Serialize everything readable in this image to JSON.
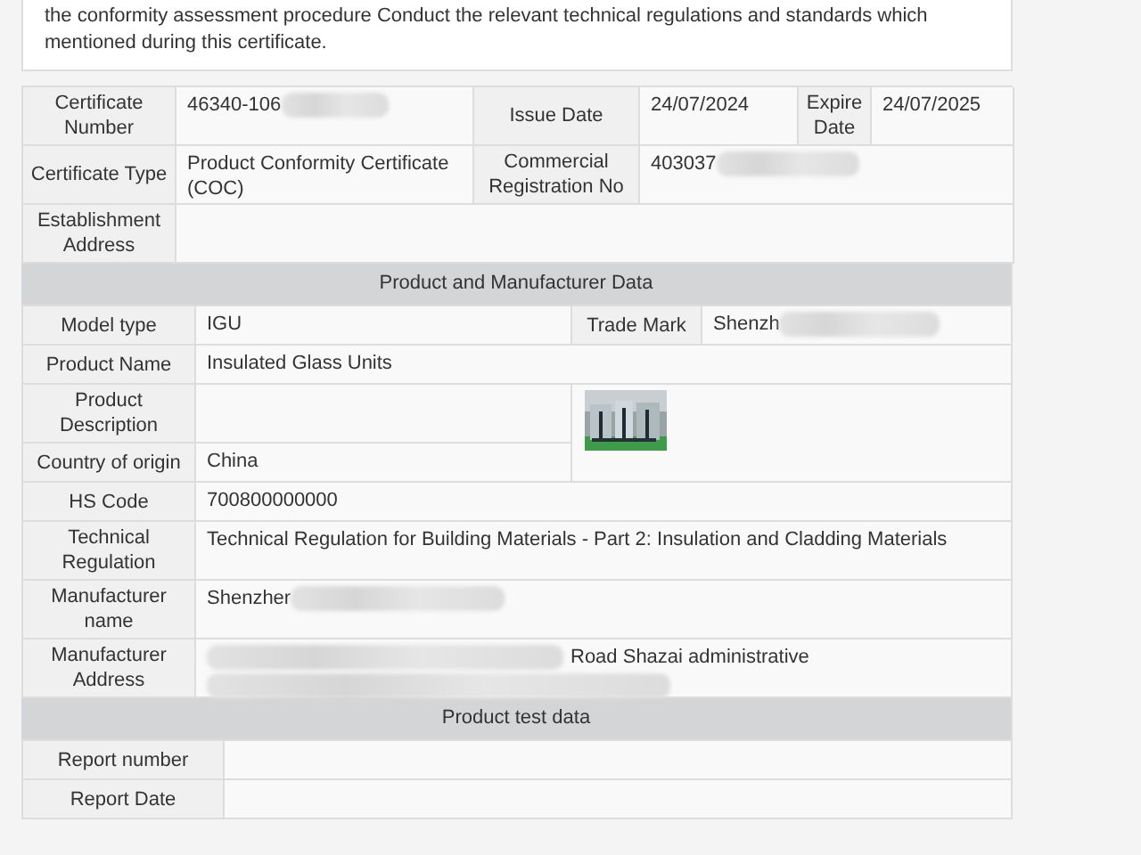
{
  "intro": {
    "lines": [
      "the conformity assessment procedure Conduct the relevant technical regulations and standards which",
      "mentioned during this certificate."
    ]
  },
  "certificate": {
    "certificate_number": {
      "label": "Certificate Number",
      "value": "46340-106"
    },
    "issue_date": {
      "label": "Issue Date",
      "value": "24/07/2024"
    },
    "expire_date": {
      "label": "Expire Date",
      "value": "24/07/2025"
    },
    "certificate_type": {
      "label": "Certificate Type",
      "value": "Product Conformity Certificate (COC)"
    },
    "commercial_registration": {
      "label": "Commercial Registration No",
      "value": "403037"
    },
    "establishment_address": {
      "label": "Establishment Address"
    }
  },
  "product_section": {
    "title": "Product and Manufacturer Data",
    "model_type": {
      "label": "Model type",
      "value": "IGU"
    },
    "trade_mark": {
      "label": "Trade Mark",
      "value": "Shenzh"
    },
    "product_name": {
      "label": "Product Name",
      "value": "Insulated Glass Units"
    },
    "product_description": {
      "label": "Product Description"
    },
    "country_of_origin": {
      "label": "Country of origin",
      "value": "China"
    },
    "hs_code": {
      "label": "HS Code",
      "value": "700800000000"
    },
    "technical_regulation": {
      "label": "Technical Regulation",
      "value": "Technical Regulation for Building Materials - Part 2: Insulation and Cladding Materials"
    },
    "manufacturer_name": {
      "label": "Manufacturer name",
      "value": "Shenzher"
    },
    "manufacturer_address": {
      "label": "Manufacturer Address",
      "value": "Road Shazai administrative"
    }
  },
  "test_section": {
    "title": "Product test data",
    "rows": [
      {
        "label": "Report number"
      },
      {
        "label": "Report Date"
      }
    ]
  }
}
